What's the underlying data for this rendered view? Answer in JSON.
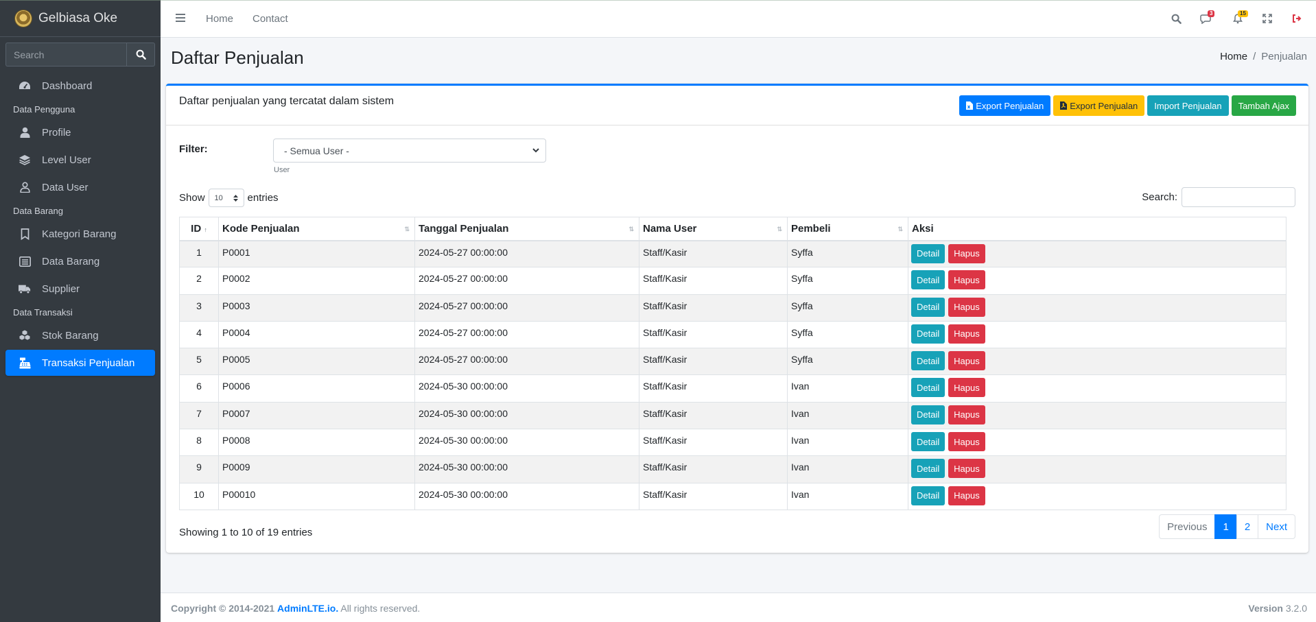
{
  "brand": {
    "name": "Gelbiasa Oke"
  },
  "sidebar": {
    "search_placeholder": "Search",
    "items": [
      {
        "type": "item",
        "label": "Dashboard",
        "icon": "dashboard-icon"
      },
      {
        "type": "header",
        "label": "Data Pengguna"
      },
      {
        "type": "item",
        "label": "Profile",
        "icon": "user-icon"
      },
      {
        "type": "item",
        "label": "Level User",
        "icon": "layers-icon"
      },
      {
        "type": "item",
        "label": "Data User",
        "icon": "user-outline-icon"
      },
      {
        "type": "header",
        "label": "Data Barang"
      },
      {
        "type": "item",
        "label": "Kategori Barang",
        "icon": "bookmark-icon"
      },
      {
        "type": "item",
        "label": "Data Barang",
        "icon": "list-icon"
      },
      {
        "type": "item",
        "label": "Supplier",
        "icon": "truck-icon"
      },
      {
        "type": "header",
        "label": "Data Transaksi"
      },
      {
        "type": "item",
        "label": "Stok Barang",
        "icon": "cubes-icon"
      },
      {
        "type": "item",
        "label": "Transaksi Penjualan",
        "icon": "cash-register-icon",
        "active": true
      }
    ]
  },
  "topbar": {
    "links": [
      "Home",
      "Contact"
    ],
    "messages_count": "3",
    "notifications_count": "15"
  },
  "header": {
    "title": "Daftar Penjualan",
    "breadcrumb_home": "Home",
    "breadcrumb_current": "Penjualan"
  },
  "card": {
    "title": "Daftar penjualan yang tercatat dalam sistem",
    "buttons": {
      "export_excel": "Export Penjualan",
      "export_pdf": "Export Penjualan",
      "import": "Import Penjualan",
      "tambah_ajax": "Tambah Ajax"
    },
    "filter": {
      "label": "Filter:",
      "selected": "- Semua User -",
      "help": "User"
    },
    "table_controls": {
      "show_label": "Show",
      "length_value": "10",
      "entries_label": "entries",
      "search_label": "Search:"
    },
    "table": {
      "columns": [
        "ID",
        "Kode Penjualan",
        "Tanggal Penjualan",
        "Nama User",
        "Pembeli",
        "Aksi"
      ],
      "detail_label": "Detail",
      "hapus_label": "Hapus",
      "rows": [
        [
          "1",
          "P0001",
          "2024-05-27 00:00:00",
          "Staff/Kasir",
          "Syffa"
        ],
        [
          "2",
          "P0002",
          "2024-05-27 00:00:00",
          "Staff/Kasir",
          "Syffa"
        ],
        [
          "3",
          "P0003",
          "2024-05-27 00:00:00",
          "Staff/Kasir",
          "Syffa"
        ],
        [
          "4",
          "P0004",
          "2024-05-27 00:00:00",
          "Staff/Kasir",
          "Syffa"
        ],
        [
          "5",
          "P0005",
          "2024-05-27 00:00:00",
          "Staff/Kasir",
          "Syffa"
        ],
        [
          "6",
          "P0006",
          "2024-05-30 00:00:00",
          "Staff/Kasir",
          "Ivan"
        ],
        [
          "7",
          "P0007",
          "2024-05-30 00:00:00",
          "Staff/Kasir",
          "Ivan"
        ],
        [
          "8",
          "P0008",
          "2024-05-30 00:00:00",
          "Staff/Kasir",
          "Ivan"
        ],
        [
          "9",
          "P0009",
          "2024-05-30 00:00:00",
          "Staff/Kasir",
          "Ivan"
        ],
        [
          "10",
          "P00010",
          "2024-05-30 00:00:00",
          "Staff/Kasir",
          "Ivan"
        ]
      ]
    },
    "info": "Showing 1 to 10 of 19 entries",
    "pagination": {
      "previous": "Previous",
      "pages": [
        "1",
        "2"
      ],
      "active_page": "1",
      "next": "Next"
    }
  },
  "footer": {
    "copyright_prefix": "Copyright © 2014-2021",
    "link": "AdminLTE.io.",
    "suffix": "All rights reserved.",
    "version_label": "Version",
    "version": "3.2.0"
  },
  "colors": {
    "primary": "#007bff",
    "warning": "#ffc107",
    "info": "#17a2b8",
    "success": "#28a745",
    "danger": "#dc3545",
    "sidebar_bg": "#343a40"
  }
}
